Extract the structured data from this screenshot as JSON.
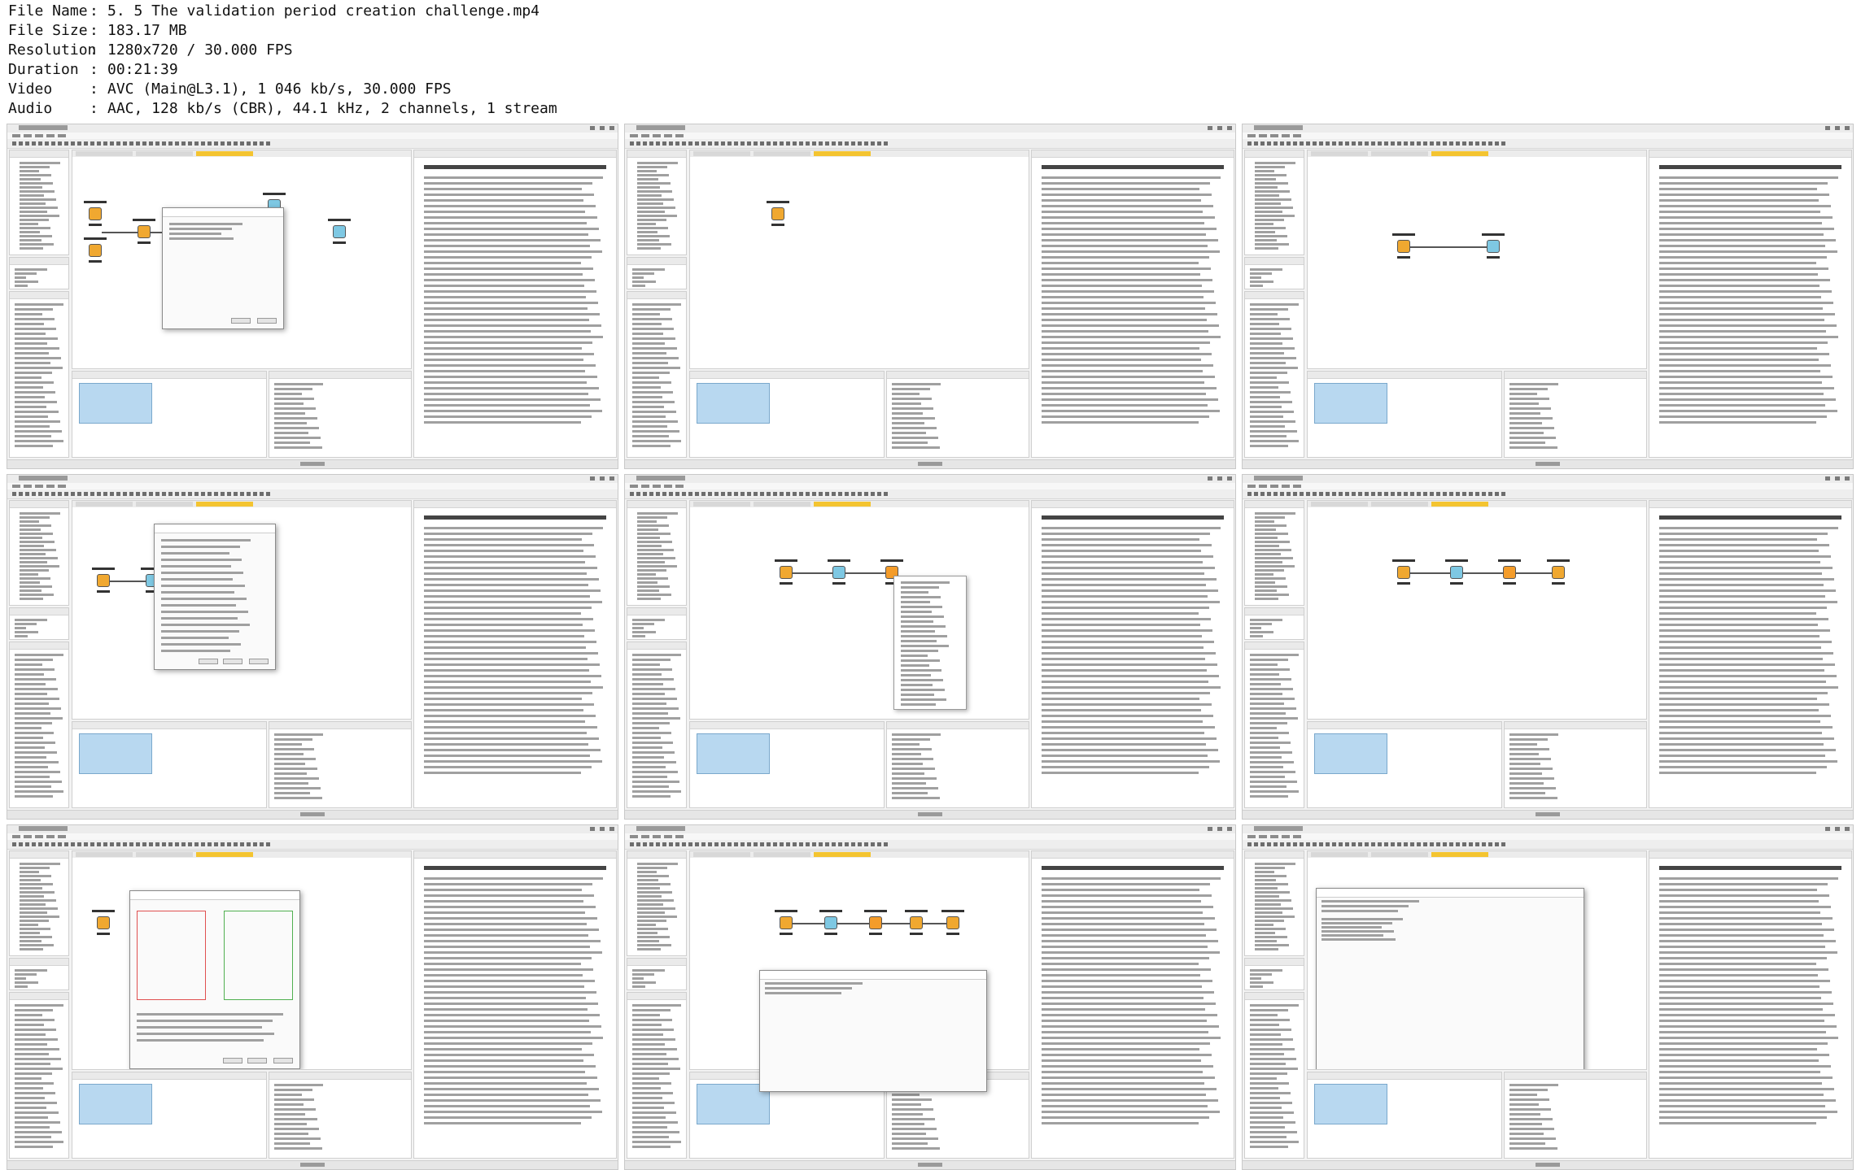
{
  "media_info": [
    {
      "key": "File Name",
      "value": "5. 5 The validation period creation challenge.mp4"
    },
    {
      "key": "File Size",
      "value": "183.17 MB"
    },
    {
      "key": "Resolution",
      "value": "1280x720 / 30.000 FPS"
    },
    {
      "key": "Duration",
      "value": "00:21:39"
    },
    {
      "key": "Video",
      "value": "AVC (Main@L3.1), 1 046 kb/s, 30.000 FPS"
    },
    {
      "key": "Audio",
      "value": "AAC, 128 kb/s (CBR), 44.1 kHz, 2 channels, 1 stream"
    }
  ],
  "thumbnails": [
    {
      "name": "thumb-1-new-workflow-wizard"
    },
    {
      "name": "thumb-2-excel-reader-description"
    },
    {
      "name": "thumb-3-table-row-to-variable-loop-start"
    },
    {
      "name": "thumb-4-create-datetime-range-dialog"
    },
    {
      "name": "thumb-5-node-context-menu"
    },
    {
      "name": "thumb-6-extract-datetime-fields"
    },
    {
      "name": "thumb-7-pivoting-dialog"
    },
    {
      "name": "thumb-8-pivot-table-output"
    },
    {
      "name": "thumb-9-loop-end-collected-results"
    }
  ]
}
